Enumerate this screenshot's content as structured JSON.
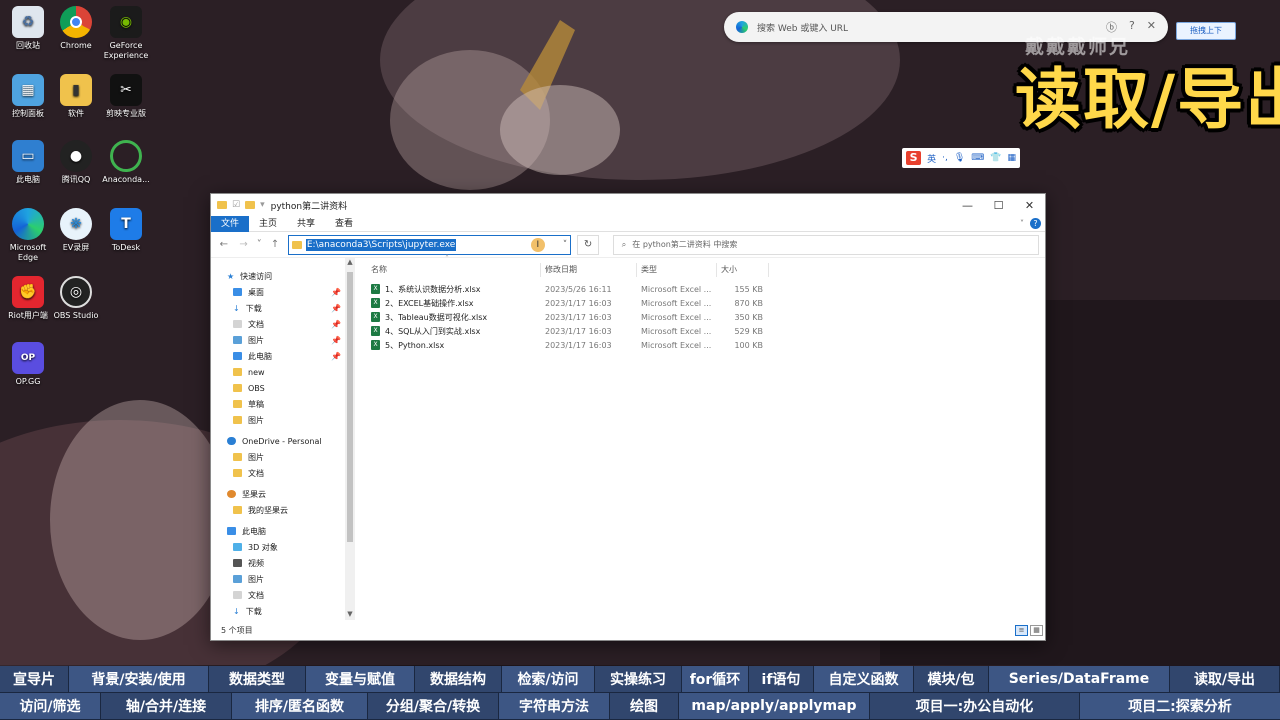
{
  "desktop": {
    "icons": [
      {
        "label": "回收站",
        "icon": "recycle-bin-icon"
      },
      {
        "label": "Chrome",
        "icon": "chrome-icon"
      },
      {
        "label": "GeForce Experience",
        "icon": "nvidia-icon"
      },
      {
        "label": "控制面板",
        "icon": "control-panel-icon"
      },
      {
        "label": "软件",
        "icon": "folder-icon"
      },
      {
        "label": "剪映专业版",
        "icon": "capcut-icon"
      },
      {
        "label": "此电脑",
        "icon": "computer-icon"
      },
      {
        "label": "腾讯QQ",
        "icon": "qq-icon"
      },
      {
        "label": "Anaconda...",
        "icon": "anaconda-icon"
      },
      {
        "label": "Microsoft Edge",
        "icon": "edge-icon"
      },
      {
        "label": "EV录屏",
        "icon": "ev-recorder-icon"
      },
      {
        "label": "ToDesk",
        "icon": "todesk-icon"
      },
      {
        "label": "Riot用户端",
        "icon": "riot-icon"
      },
      {
        "label": "OBS Studio",
        "icon": "obs-icon"
      },
      {
        "label": "OP.GG",
        "icon": "opgg-icon"
      }
    ]
  },
  "edge_bar": {
    "placeholder": "搜索 Web 或键入 URL",
    "pin_label": "拖拽上下"
  },
  "overlay": {
    "watermark": "戴戴戴师兄",
    "title": "读取/导出"
  },
  "ime": {
    "logo": "S",
    "lang": "英"
  },
  "explorer": {
    "window_title": "python第二讲资料",
    "ribbon_tabs": [
      "文件",
      "主页",
      "共享",
      "查看"
    ],
    "address": "E:\\anaconda3\\Scripts\\jupyter.exe",
    "search_placeholder": "在 python第二讲资料 中搜索",
    "nav": {
      "quick_access": "快速访问",
      "quick_items": [
        "桌面",
        "下载",
        "文档",
        "图片",
        "此电脑",
        "new",
        "OBS",
        "草稿",
        "图片"
      ],
      "onedrive": "OneDrive - Personal",
      "onedrive_items": [
        "图片",
        "文档"
      ],
      "jianguoyun": "坚果云",
      "jianguoyun_items": [
        "我的坚果云"
      ],
      "this_pc": "此电脑",
      "this_pc_items": [
        "3D 对象",
        "视频",
        "图片",
        "文档",
        "下载"
      ]
    },
    "columns": {
      "name": "名称",
      "date": "修改日期",
      "type": "类型",
      "size": "大小"
    },
    "files": [
      {
        "name": "1、系统认识数据分析.xlsx",
        "date": "2023/5/26 16:11",
        "type": "Microsoft Excel ...",
        "size": "155 KB"
      },
      {
        "name": "2、EXCEL基础操作.xlsx",
        "date": "2023/1/17 16:03",
        "type": "Microsoft Excel ...",
        "size": "870 KB"
      },
      {
        "name": "3、Tableau数据可视化.xlsx",
        "date": "2023/1/17 16:03",
        "type": "Microsoft Excel ...",
        "size": "350 KB"
      },
      {
        "name": "4、SQL从入门到实战.xlsx",
        "date": "2023/1/17 16:03",
        "type": "Microsoft Excel ...",
        "size": "529 KB"
      },
      {
        "name": "5、Python.xlsx",
        "date": "2023/1/17 16:03",
        "type": "Microsoft Excel ...",
        "size": "100 KB"
      }
    ],
    "status": "5 个项目"
  },
  "topics_row1": [
    "宣导片",
    "背景/安装/使用",
    "数据类型",
    "变量与赋值",
    "数据结构",
    "检索/访问",
    "实操练习",
    "for循环",
    "if语句",
    "自定义函数",
    "模块/包",
    "Series/DataFrame",
    "读取/导出"
  ],
  "topics_row2": [
    "访问/筛选",
    "轴/合并/连接",
    "排序/匿名函数",
    "分组/聚合/转换",
    "字符串方法",
    "绘图",
    "map/apply/applymap",
    "项目一:办公自动化",
    "项目二:探索分析"
  ]
}
